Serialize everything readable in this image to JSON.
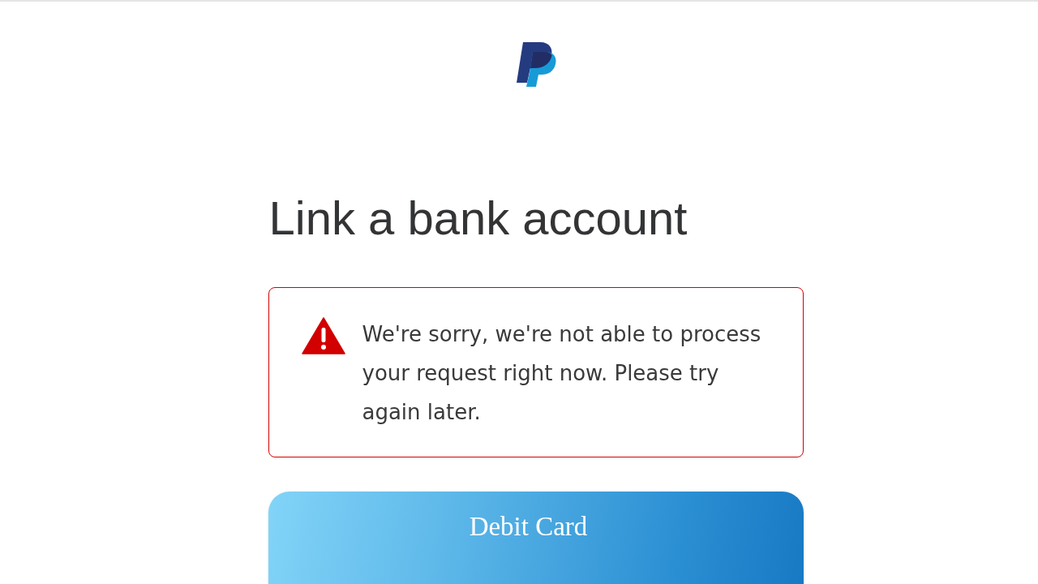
{
  "heading": "Link a bank account",
  "alert": {
    "kind": "error",
    "message": "We're sorry, we're not able to process your request right now. Please try again later."
  },
  "cards": [
    {
      "label": "Debit Card"
    }
  ]
}
